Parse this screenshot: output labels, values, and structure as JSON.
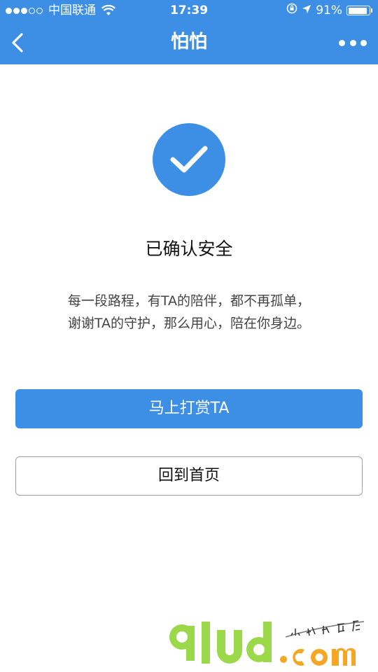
{
  "status_bar": {
    "carrier": "中国联通",
    "time": "17:39",
    "battery_percent": "91%",
    "battery_level": 0.91,
    "signal_bars_on": 3,
    "signal_bars_total": 5
  },
  "nav": {
    "title": "怕怕",
    "back_icon": "chevron-left-icon",
    "more_icon": "more-dots-icon"
  },
  "result": {
    "icon": "check-circle-icon",
    "title": "已确认安全",
    "description_line1": "每一段路程，有TA的陪伴，都不再孤单，",
    "description_line2": "谢谢TA的守护，那么用心，陪在你身边。"
  },
  "buttons": {
    "reward_label": "马上打赏TA",
    "home_label": "回到首页"
  },
  "colors": {
    "accent": "#3d8fe6",
    "watermark_green": "#9bd94a",
    "watermark_orange": "#f5a623"
  }
}
